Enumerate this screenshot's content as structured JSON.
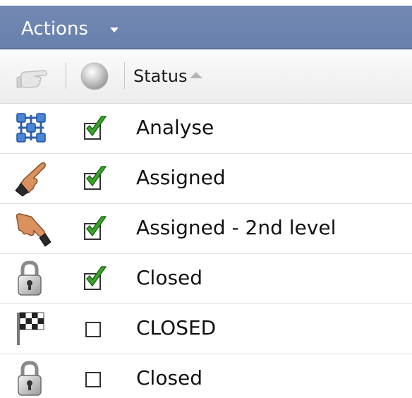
{
  "toolbar": {
    "actions_label": "Actions"
  },
  "header": {
    "status_label": "Status",
    "sort_direction": "ascending",
    "col1_icon": "hand-pointer-icon",
    "col2_icon": "gray-sphere-icon"
  },
  "rows": [
    {
      "label": "Analyse",
      "icon": "network-nodes-icon",
      "checked": true
    },
    {
      "label": "Assigned",
      "icon": "pointing-hand-icon",
      "checked": true
    },
    {
      "label": "Assigned - 2nd level",
      "icon": "pointing-hand-down-icon",
      "checked": true
    },
    {
      "label": "Closed",
      "icon": "padlock-icon",
      "checked": true
    },
    {
      "label": "CLOSED",
      "icon": "checkered-flag-icon",
      "checked": false
    },
    {
      "label": "Closed",
      "icon": "padlock-icon",
      "checked": false
    }
  ],
  "colors": {
    "actions_bar": "#6f86b0",
    "check_green": "#3aa52a"
  }
}
